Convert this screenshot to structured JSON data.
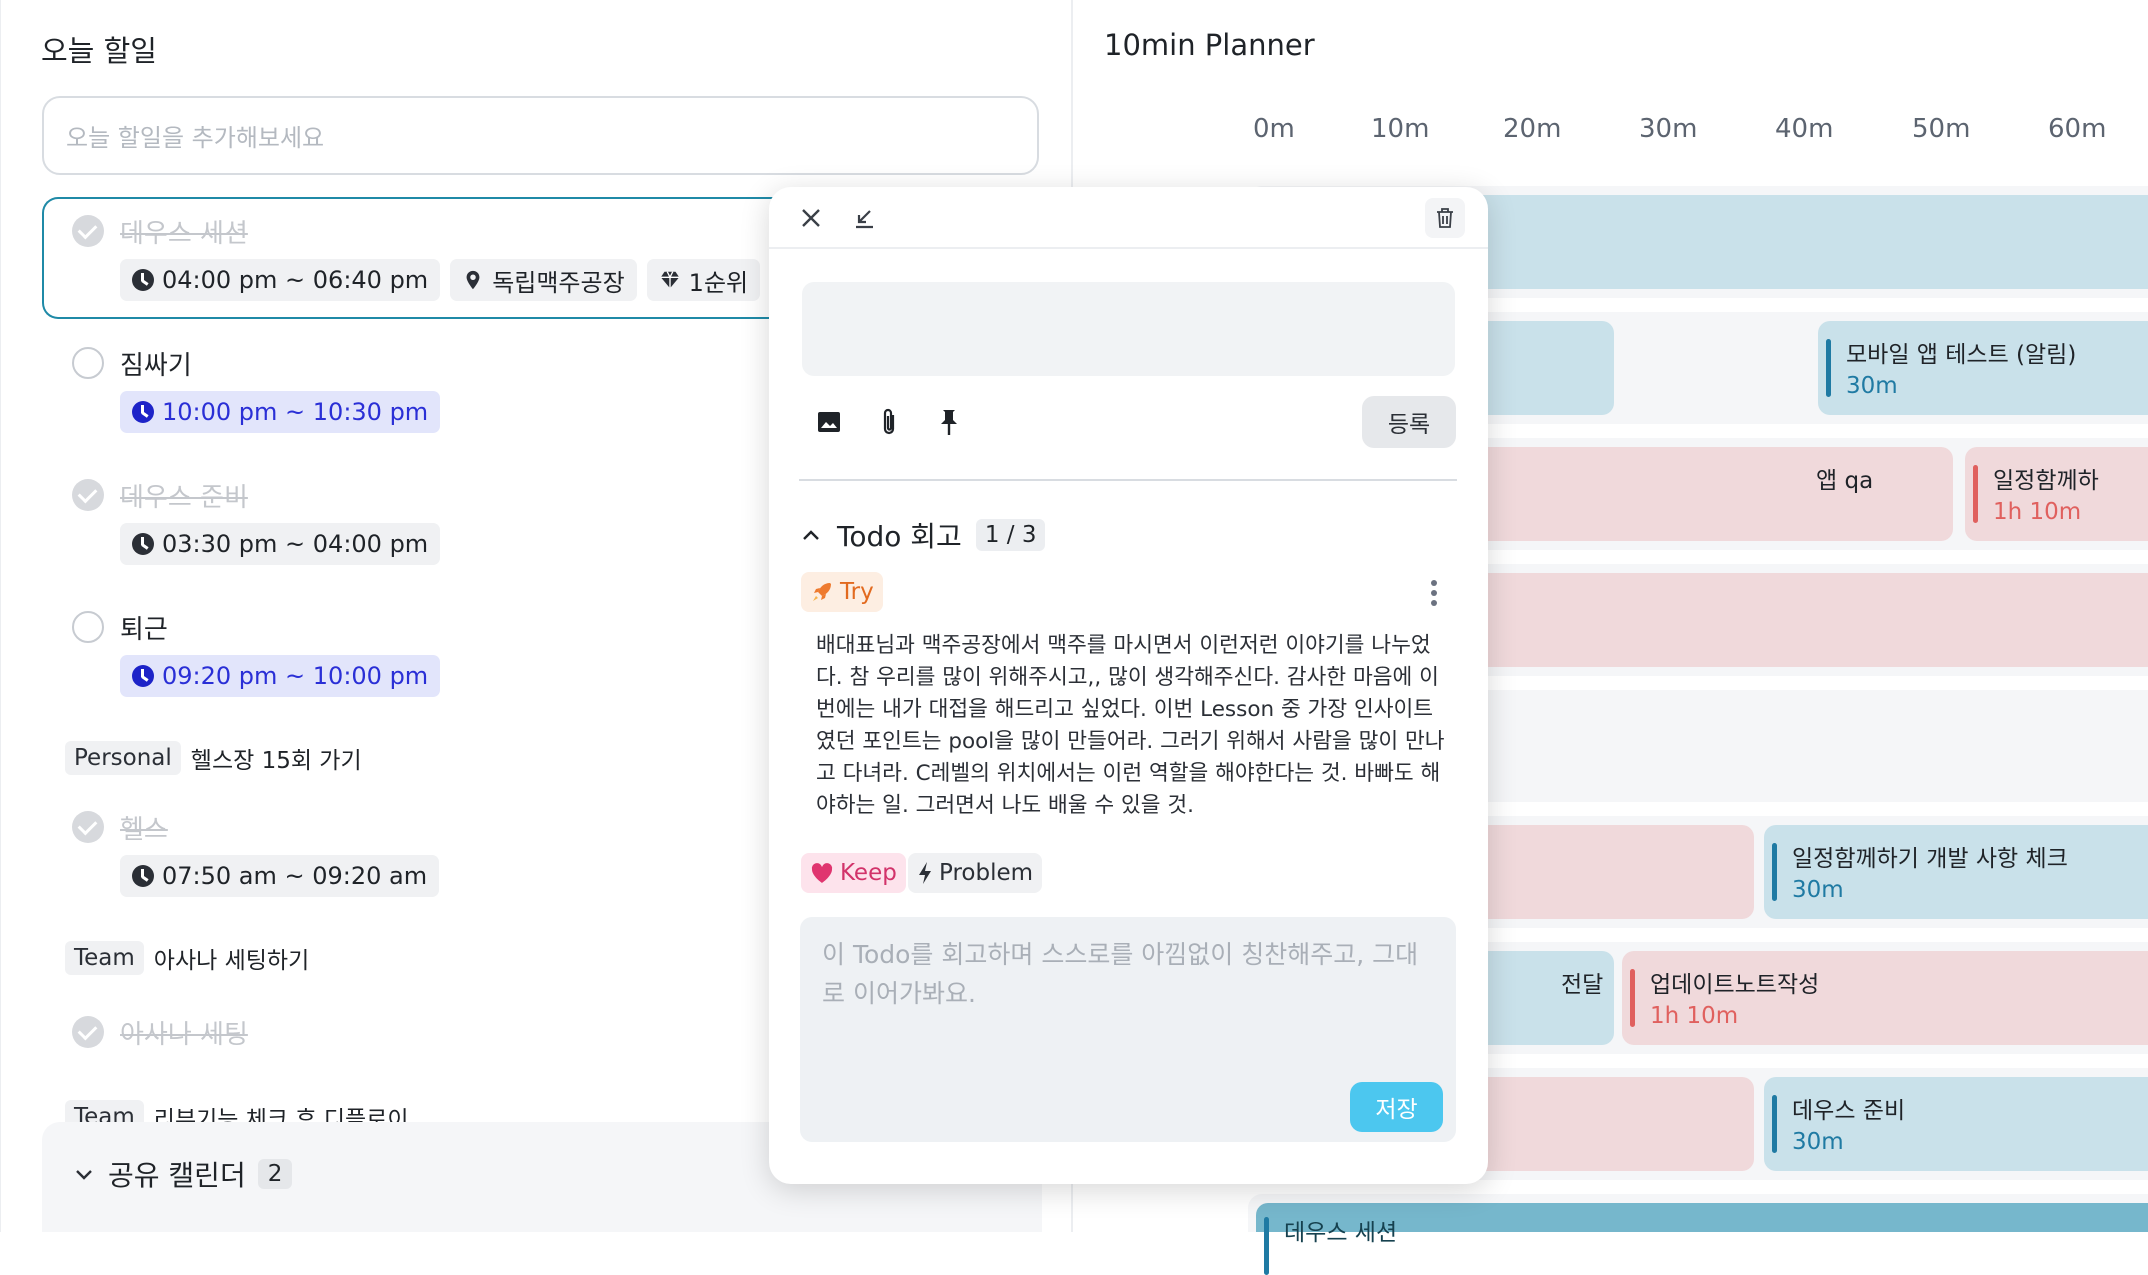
{
  "left": {
    "title": "오늘 할일",
    "input_placeholder": "오늘 할일을 추가해보세요",
    "tasks": [
      {
        "name": "데우스 세션",
        "time": "04:00 pm ~ 06:40 pm",
        "place": "독립맥주공장",
        "priority": "1순위",
        "done": true
      },
      {
        "name": "짐싸기",
        "time": "10:00 pm ~ 10:30 pm",
        "done": false
      },
      {
        "name": "데우스 준비",
        "time": "03:30 pm ~ 04:00 pm",
        "done": true
      },
      {
        "name": "퇴근",
        "time": "09:20 pm ~ 10:00 pm",
        "done": false
      },
      {
        "tag": "Personal",
        "name": "헬스장 15회 가기"
      },
      {
        "name": "헬스",
        "time": "07:50 am ~ 09:20 am",
        "done": true
      },
      {
        "tag": "Team",
        "name": "아사나 세팅하기"
      },
      {
        "name": "아사나 세팅",
        "done": true
      },
      {
        "tag": "Team",
        "name": "리뷰기능 체크 후 디플로이"
      }
    ],
    "shared_calendar": {
      "label": "공유 캘린더",
      "count": "2"
    }
  },
  "planner": {
    "title": "10min Planner",
    "minutes": [
      "0m",
      "10m",
      "20m",
      "30m",
      "40m",
      "50m",
      "60m"
    ],
    "events": [
      {
        "name": "모바일 앱 테스트 (알림)",
        "duration": "30m",
        "color": "blue"
      },
      {
        "name": "일정함께하",
        "duration": "1h 10m",
        "color": "red"
      },
      {
        "name": "앱 qa",
        "color": "red"
      },
      {
        "name": "일정함께하기 개발 사항 체크",
        "duration": "30m",
        "color": "blue"
      },
      {
        "name": "전달",
        "color": "blue"
      },
      {
        "name": "업데이트노트작성",
        "duration": "1h 10m",
        "color": "red"
      },
      {
        "name": "데우스 준비",
        "duration": "30m",
        "color": "blue"
      },
      {
        "name": "데우스 세션",
        "color": "blue"
      }
    ]
  },
  "popup": {
    "submit_label": "등록",
    "section_title": "Todo 회고",
    "section_count": "1 / 3",
    "try_label": "Try",
    "retro_text": "배대표님과 맥주공장에서 맥주를 마시면서 이런저런 이야기를 나누었다. 참 우리를 많이 위해주시고,, 많이 생각해주신다. 감사한 마음에 이번에는 내가 대접을 해드리고 싶었다. 이번 Lesson 중 가장 인사이트였던 포인트는 pool을 많이 만들어라. 그러기 위해서 사람을 많이 만나고 다녀라. C레벨의 위치에서는 이런 역할을 해야한다는 것. 바빠도 해야하는 일. 그러면서 나도 배울 수 있을 것.",
    "keep_label": "Keep",
    "problem_label": "Problem",
    "reply_placeholder": "이 Todo를 회고하며 스스로를 아낌없이 칭찬해주고, 그대로 이어가봐요.",
    "save_label": "저장"
  }
}
